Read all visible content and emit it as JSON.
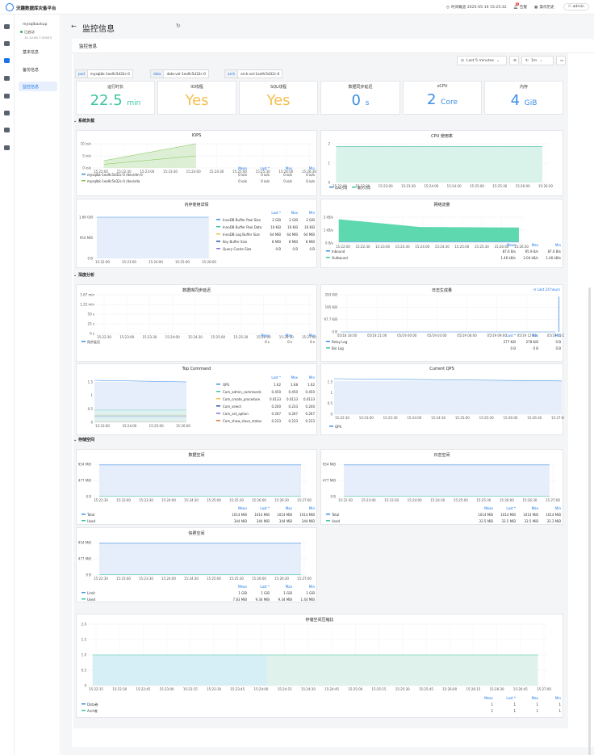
{
  "app": {
    "title": "沃趣数据库灾备平台",
    "time_label": "时间概览 2025-05-19 15:25:32",
    "alerts_label": "告警",
    "alerts_count": "8",
    "ops_label": "操作历史",
    "user": "admin"
  },
  "sidebar": {
    "instance": "mysqlbackup",
    "status": "已启动",
    "ip": "10.10.60.7:30053",
    "items": [
      {
        "label": "基本信息"
      },
      {
        "label": "备份信息"
      },
      {
        "label": "监控信息"
      }
    ]
  },
  "page": {
    "title": "监控信息",
    "section": "监控信息"
  },
  "toolbar": {
    "range": "Last 5 minutes",
    "refresh": "1m"
  },
  "vars": [
    {
      "k": "pod",
      "v": "mysqlbk-1ea9c5d32c-0"
    },
    {
      "k": "data",
      "v": "data-vol-1ea9c5d32c-0"
    },
    {
      "k": "arch",
      "v": "arch-vol-1ea9c5d32c-0"
    }
  ],
  "stats": [
    {
      "title": "运行时长",
      "value": "22.5",
      "unit": "min",
      "color": "#3ec4a3"
    },
    {
      "title": "IO线程",
      "value": "Yes",
      "unit": "",
      "color": "#f5bf4f"
    },
    {
      "title": "SQL线程",
      "value": "Yes",
      "unit": "",
      "color": "#f5bf4f"
    },
    {
      "title": "数据同步延迟",
      "value": "0",
      "unit": "s",
      "color": "#3b8de5"
    },
    {
      "title": "vCPU",
      "value": "2",
      "unit": "Core",
      "color": "#3b8de5"
    },
    {
      "title": "内存",
      "value": "4",
      "unit": "GiB",
      "color": "#3b8de5"
    }
  ],
  "rows": {
    "r1": "系统负载",
    "r2": "深度分析",
    "r3": "存储空间"
  },
  "panels": {
    "iops": {
      "title": "IOPS",
      "y": [
        "10 io/s",
        "5 io/s",
        "0 io/s"
      ],
      "x": [
        "15:22:00",
        "15:22:30",
        "15:23:00",
        "15:23:30",
        "15:24:00",
        "15:24:30",
        "15:25:00",
        "15:25:30",
        "15:26:00",
        "15:26:30"
      ],
      "cols": [
        "Mean",
        "Last *",
        "Max",
        "Min"
      ],
      "legend": [
        {
          "name": "mysqlbk-1ea9c5d32c-0 /dev/dm-0",
          "vals": [
            "0 io/s",
            "0 io/s",
            "0 io/s",
            "0 io/s"
          ],
          "color": "#3b8de5"
        },
        {
          "name": "mysqlbk-1ea9c5d32c-0 /dev/sda",
          "vals": [
            "0 io/s",
            "0 io/s",
            "0 io/s",
            "0 io/s"
          ],
          "color": "#7ec651"
        }
      ]
    },
    "cpu": {
      "title": "CPU 使用率",
      "y": [
        "2",
        "1",
        "0"
      ],
      "x": [
        "15:22:00",
        "15:22:30",
        "15:23:00",
        "15:23:30",
        "15:24:00",
        "15:24:30",
        "15:25:00",
        "15:25:30",
        "15:26:00",
        "15:26:30"
      ],
      "legend": [
        {
          "name": "cpu占用",
          "color": "#3b8de5"
        },
        {
          "name": "最大可用",
          "color": "#3ec4a3"
        }
      ]
    },
    "mem": {
      "title": "内存使用详情",
      "y": [
        "1.86 GiB",
        "954 MiB",
        "0 B"
      ],
      "x": [
        "15:22:00",
        "15:23:00",
        "15:24:00",
        "15:25:00",
        "15:26:00"
      ],
      "cols": [
        "Last *",
        "Max",
        "Min"
      ],
      "legend": [
        {
          "name": "InnoDB Buffer Pool Size",
          "vals": [
            "2 GiB",
            "2 GiB",
            "2 GiB"
          ],
          "color": "#3b8de5"
        },
        {
          "name": "InnoDB Buffer Pool Data",
          "vals": [
            "16 KiB",
            "16 KiB",
            "16 KiB"
          ],
          "color": "#3ec4a3"
        },
        {
          "name": "InnoDB Log Buffer Size",
          "vals": [
            "64 MiB",
            "64 MiB",
            "64 MiB"
          ],
          "color": "#f5bf4f"
        },
        {
          "name": "Key Buffer Size",
          "vals": [
            "8 MiB",
            "8 MiB",
            "8 MiB"
          ],
          "color": "#1f4fa8"
        },
        {
          "name": "Query Cache Size",
          "vals": [
            "0 B",
            "0 B",
            "0 B"
          ],
          "color": "#8e6bd8"
        }
      ]
    },
    "net": {
      "title": "网络流量",
      "y": [
        "2 kB/s",
        "1 kB/s",
        "0 B/s"
      ],
      "x": [
        "15:22:00",
        "15:22:30",
        "15:23:00",
        "15:23:30",
        "15:24:00",
        "15:24:30",
        "15:25:00",
        "15:25:30",
        "15:26:00",
        "15:26:30"
      ],
      "cols": [
        "Mean",
        "Max",
        "Min"
      ],
      "legend": [
        {
          "name": "Inbound",
          "vals": [
            "87.6 B/s",
            "95.9 B/s",
            "87.6 B/s"
          ],
          "color": "#3b8de5"
        },
        {
          "name": "Outbound",
          "vals": [
            "1.46 kB/s",
            "2.04 kB/s",
            "1.46 kB/s"
          ],
          "color": "#3ec4a3"
        }
      ]
    },
    "lag": {
      "title": "数据库同步延迟",
      "y": [
        "1.67 min",
        "1.25 min",
        "50 s",
        "25 s",
        "0 s"
      ],
      "x": [
        "15:22:30",
        "15:23:00",
        "15:23:30",
        "15:24:00",
        "15:24:30",
        "15:25:00",
        "15:25:30",
        "15:26:00",
        "15:26:30",
        "15:27:00"
      ],
      "cols": [
        "Mean",
        "Max",
        "Min"
      ],
      "legend": [
        {
          "name": "同步延迟",
          "vals": [
            "0 s",
            "0 s",
            "0 s"
          ],
          "color": "#3b8de5"
        }
      ]
    },
    "log": {
      "title": "日志生成量",
      "link": "Last 24 hours",
      "y": [
        "293 KiB",
        "195 KiB",
        "97.7 KiB",
        "0 B"
      ],
      "x": [
        "05/18 18:00",
        "05/18 21:00",
        "05/19 00:00",
        "05/19 03:00",
        "05/19 06:00",
        "05/19 09:00",
        "05/19 12:00",
        "05/19 15:00"
      ],
      "cols": [
        "Last *",
        "Max",
        "Min"
      ],
      "legend": [
        {
          "name": "Relay Log",
          "vals": [
            "277 KiB",
            "278 KiB",
            "0 B"
          ],
          "color": "#3b8de5"
        },
        {
          "name": "Bin Log",
          "vals": [
            "0 B",
            "0 B",
            "0 B"
          ],
          "color": "#3ec4a3"
        }
      ]
    },
    "topcmd": {
      "title": "Top Command",
      "y": [
        "1.5",
        "1",
        "0.5",
        "0"
      ],
      "x": [
        "15:23:00",
        "15:24:00",
        "15:25:00",
        "15:26:00"
      ],
      "cols": [
        "Last *",
        "Max",
        "Min"
      ],
      "legend": [
        {
          "name": "QPS",
          "vals": [
            "1.62",
            "1.68",
            "1.62"
          ],
          "color": "#3b8de5"
        },
        {
          "name": "Com_admin_commands",
          "vals": [
            "0.450",
            "0.450",
            "0.450"
          ],
          "color": "#3ec4a3"
        },
        {
          "name": "Com_create_procedure",
          "vals": [
            "0.0133",
            "0.0133",
            "0.0133"
          ],
          "color": "#f5bf4f"
        },
        {
          "name": "Com_select",
          "vals": [
            "0.200",
            "0.233",
            "0.200"
          ],
          "color": "#1f4fa8"
        },
        {
          "name": "Com_set_option",
          "vals": [
            "0.267",
            "0.267",
            "0.267"
          ],
          "color": "#8e6bd8"
        },
        {
          "name": "Com_show_slave_status",
          "vals": [
            "0.233",
            "0.233",
            "0.233"
          ],
          "color": "#e8743b"
        }
      ]
    },
    "qps": {
      "title": "Current QPS",
      "y": [
        "1.5",
        "1",
        "0.5",
        "0"
      ],
      "x": [
        "15:22:30",
        "15:23:00",
        "15:23:30",
        "15:24:00",
        "15:24:30",
        "15:25:00",
        "15:25:30",
        "15:26:00",
        "15:26:30",
        "15:27:00"
      ],
      "legend": [
        {
          "name": "QPS",
          "color": "#3b8de5"
        }
      ]
    },
    "dataspace": {
      "title": "数据空间",
      "y": [
        "954 MiB",
        "477 MiB",
        "0 B"
      ],
      "x": [
        "15:22:30",
        "15:23:00",
        "15:23:30",
        "15:24:00",
        "15:24:30",
        "15:25:00",
        "15:25:30",
        "15:26:00",
        "15:26:30",
        "15:27:00"
      ],
      "cols": [
        "Mean",
        "Last *",
        "Max",
        "Min"
      ],
      "legend": [
        {
          "name": "Total",
          "vals": [
            "1014 MiB",
            "1014 MiB",
            "1014 MiB",
            "1014 MiB"
          ],
          "color": "#3b8de5"
        },
        {
          "name": "Used",
          "vals": [
            "344 MiB",
            "344 MiB",
            "344 MiB",
            "344 MiB"
          ],
          "color": "#3ec4a3"
        }
      ]
    },
    "logspace": {
      "title": "日志空间",
      "y": [
        "954 MiB",
        "477 MiB",
        "0 B"
      ],
      "x": [
        "15:22:30",
        "15:23:00",
        "15:23:30",
        "15:24:00",
        "15:24:30",
        "15:25:00",
        "15:25:30",
        "15:26:00",
        "15:26:30",
        "15:27:00"
      ],
      "cols": [
        "Mean",
        "Last *",
        "Max",
        "Min"
      ],
      "legend": [
        {
          "name": "Total",
          "vals": [
            "1014 MiB",
            "1014 MiB",
            "1014 MiB",
            "1014 MiB"
          ],
          "color": "#3b8de5"
        },
        {
          "name": "Used",
          "vals": [
            "33.5 MiB",
            "33.5 MiB",
            "33.5 MiB",
            "33.3 MiB"
          ],
          "color": "#3ec4a3"
        }
      ]
    },
    "snap": {
      "title": "快照空间",
      "y": [
        "954 MiB",
        "477 MiB",
        "0 B"
      ],
      "x": [
        "15:22:30",
        "15:23:00",
        "15:23:30",
        "15:24:00",
        "15:24:30",
        "15:25:00",
        "15:25:30",
        "15:26:00",
        "15:26:30",
        "15:27:00"
      ],
      "cols": [
        "Mean",
        "Last *",
        "Max",
        "Min"
      ],
      "legend": [
        {
          "name": "Limit",
          "vals": [
            "1 GiB",
            "1 GiB",
            "1 GiB",
            "1 GiB"
          ],
          "color": "#3b8de5"
        },
        {
          "name": "Used",
          "vals": [
            "7.83 MiB",
            "9.34 MiB",
            "9.34 MiB",
            "1.44 MiB"
          ],
          "color": "#3ec4a3"
        }
      ]
    },
    "ratio": {
      "title": "存储空间压缩比",
      "y": [
        "2.0",
        "1.5",
        "1.0",
        "0.5",
        "0"
      ],
      "x": [
        "15:22:15",
        "15:22:30",
        "15:22:45",
        "15:23:00",
        "15:23:15",
        "15:23:30",
        "15:23:45",
        "15:24:00",
        "15:24:15",
        "15:24:30",
        "15:24:45",
        "15:25:00",
        "15:25:15",
        "15:25:30",
        "15:25:45",
        "15:26:00",
        "15:26:15",
        "15:26:30",
        "15:26:45",
        "15:27:00"
      ],
      "cols": [
        "Mean",
        "Last *",
        "Max",
        "Min"
      ],
      "legend": [
        {
          "name": "Data卷",
          "vals": [
            "1",
            "1",
            "1",
            "1"
          ],
          "color": "#3b8de5"
        },
        {
          "name": "Arch卷",
          "vals": [
            "1",
            "1",
            "1",
            "1"
          ],
          "color": "#3ec4a3"
        }
      ]
    }
  }
}
